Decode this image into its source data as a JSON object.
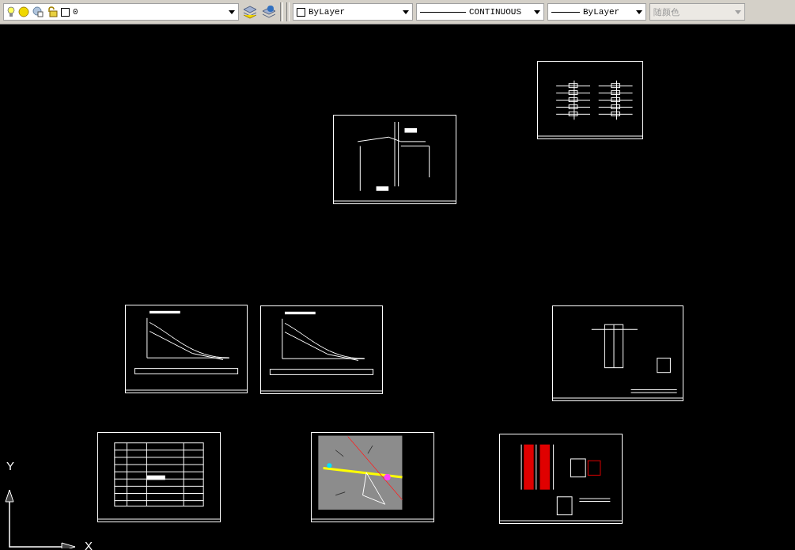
{
  "toolbar": {
    "layer": {
      "value": "0"
    },
    "color": {
      "value": "ByLayer"
    },
    "linetype": {
      "value": "CONTINUOUS"
    },
    "lineweight": {
      "value": "ByLayer"
    },
    "plot_style": {
      "value": "随颜色",
      "disabled": true
    }
  },
  "ucs_icon": {
    "y_label": "Y",
    "x_label": "X"
  }
}
